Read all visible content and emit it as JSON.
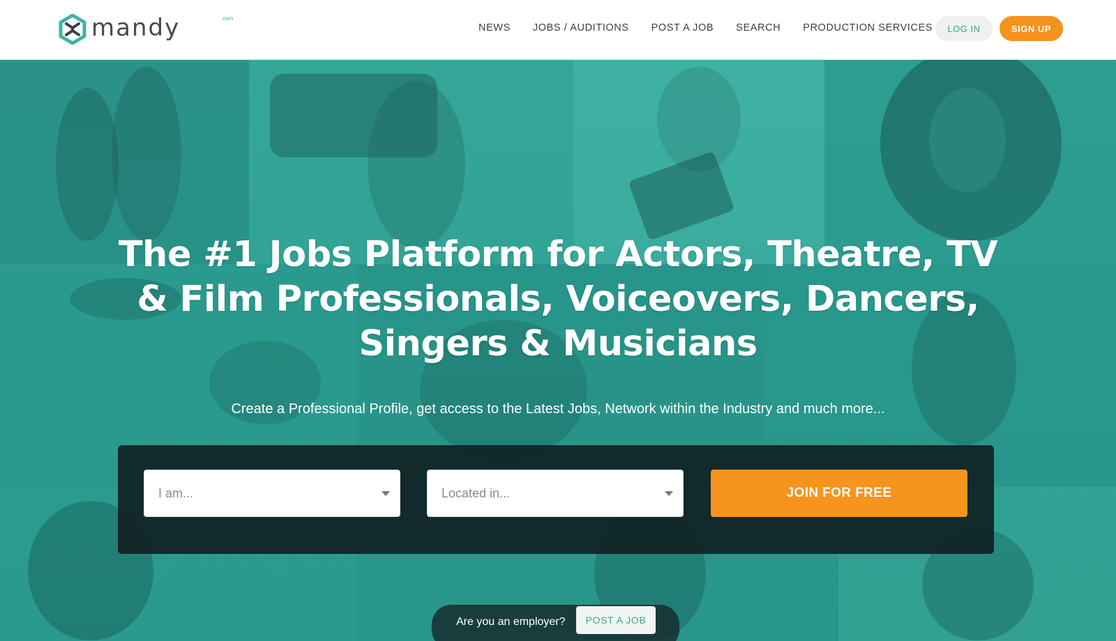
{
  "brand": {
    "name": "mandy",
    "suffix": ".com",
    "accent": "#3eb4a4",
    "orange": "#f6921e"
  },
  "nav": {
    "items": [
      {
        "label": "NEWS"
      },
      {
        "label": "JOBS / AUDITIONS"
      },
      {
        "label": "POST A JOB"
      },
      {
        "label": "SEARCH"
      },
      {
        "label": "PRODUCTION SERVICES"
      }
    ],
    "login_label": "LOG IN",
    "signup_label": "SIGN UP"
  },
  "hero": {
    "title": "The #1 Jobs Platform for Actors, Theatre, TV & Film Professionals, Voiceovers, Dancers, Singers & Musicians",
    "subtitle": "Create a Professional Profile, get access to the Latest Jobs, Network within the Industry and much more...",
    "background_tint": "#2c9e92"
  },
  "join_form": {
    "role_placeholder": "I am...",
    "location_placeholder": "Located in...",
    "join_label": "JOIN FOR FREE"
  },
  "employer": {
    "question": "Are you an employer?",
    "post_job_label": "POST A JOB"
  }
}
